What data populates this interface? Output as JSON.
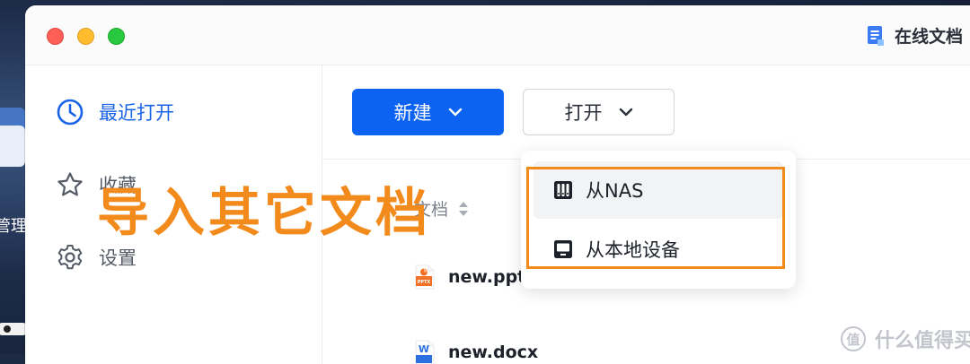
{
  "window": {
    "app_title": "在线文档"
  },
  "desktop": {
    "partial_label": "管理"
  },
  "sidebar": {
    "items": [
      {
        "label": "最近打开",
        "icon": "clock-icon"
      },
      {
        "label": "收藏",
        "icon": "star-icon"
      },
      {
        "label": "设置",
        "icon": "gear-icon"
      }
    ]
  },
  "toolbar": {
    "new_label": "新建",
    "open_label": "打开"
  },
  "file_list": {
    "column_header": "文档",
    "files": [
      {
        "name": "new.pptx",
        "icon": "pptx-file-icon"
      },
      {
        "name": "new.docx",
        "icon": "docx-file-icon"
      }
    ]
  },
  "open_menu": {
    "items": [
      {
        "label": "从NAS",
        "icon": "nas-icon"
      },
      {
        "label": "从本地设备",
        "icon": "monitor-icon"
      }
    ]
  },
  "annotation": {
    "caption": "导入其它文档"
  },
  "watermark": {
    "badge": "值",
    "text": "什么值得买"
  },
  "colors": {
    "accent": "#0c63f2",
    "annotation": "#f28a1c"
  }
}
